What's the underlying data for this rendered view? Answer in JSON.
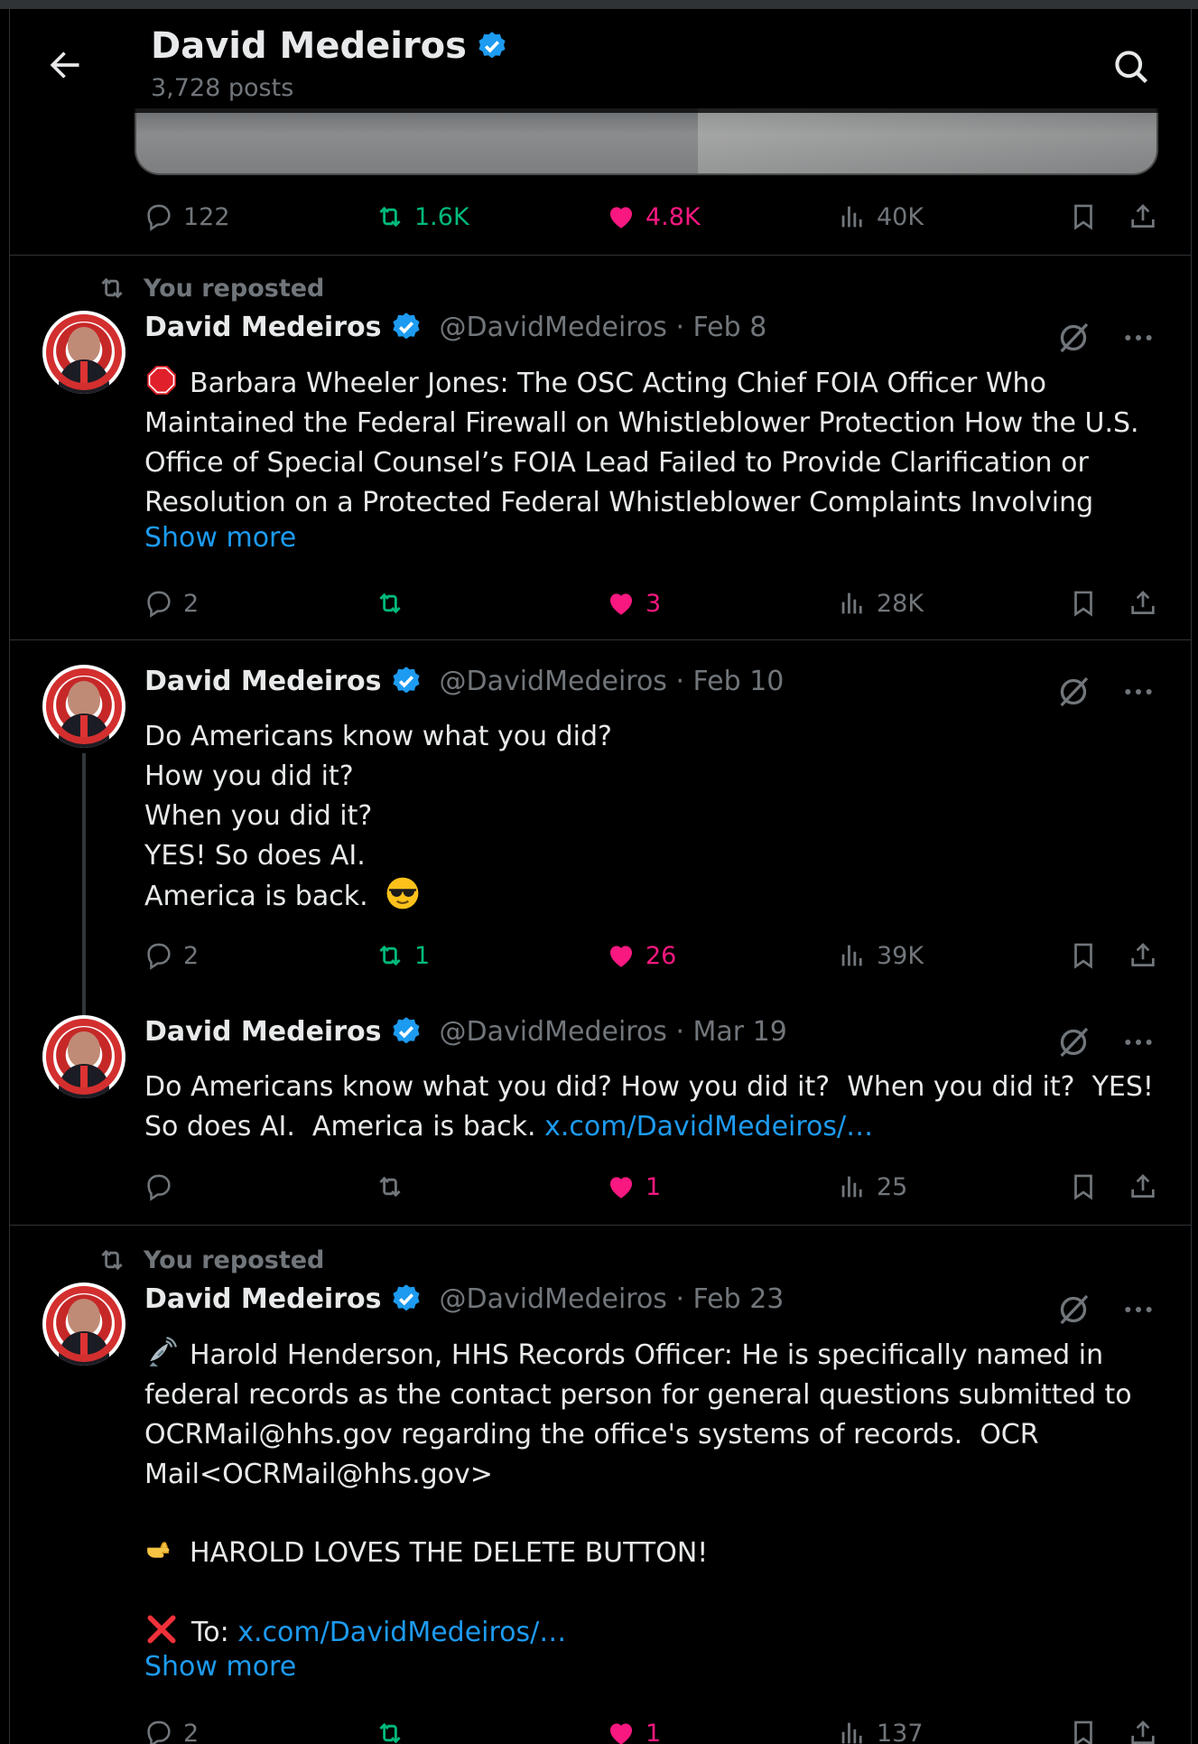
{
  "header": {
    "title": "David Medeiros",
    "posts_count": "3,728 posts",
    "back_icon": "arrow-left-icon",
    "search_icon": "search-icon"
  },
  "colors": {
    "background": "#000000",
    "text": "#e7e9ea",
    "muted": "#71767b",
    "accent_blue": "#1d9bf0",
    "repost_green": "#00ba7c",
    "like_pink": "#f91880",
    "divider": "#2f3336"
  },
  "posts": [
    {
      "metrics": {
        "replies": "122",
        "reposts": "1.6K",
        "likes": "4.8K",
        "views": "40K"
      }
    },
    {
      "reposted_label": "You reposted",
      "author": "David Medeiros",
      "handle_date": "@DavidMedeiros · Feb 8",
      "text": "Barbara Wheeler Jones: The OSC Acting Chief FOIA Officer Who\nMaintained the Federal Firewall on Whistleblower Protection How the U.S.\nOffice of Special Counsel’s FOIA Lead Failed to Provide Clarification or\nResolution on a Protected Federal Whistleblower Complaints Involving",
      "show_more": "Show more",
      "metrics": {
        "replies": "2",
        "reposts": "",
        "likes": "3",
        "views": "28K"
      }
    },
    {
      "author": "David Medeiros",
      "handle_date": "@DavidMedeiros · Feb 10",
      "text": "Do Americans know what you did?\nHow you did it?\nWhen you did it?\nYES! So does AI.\nAmerica is back.",
      "metrics": {
        "replies": "2",
        "reposts": "1",
        "likes": "26",
        "views": "39K"
      }
    },
    {
      "author": "David Medeiros",
      "handle_date": "@DavidMedeiros · Mar 19",
      "text": "Do Americans know what you did? How you did it?  When you did it?  YES!\nSo does AI.  America is back. ",
      "link": "x.com/DavidMedeiros/…",
      "metrics": {
        "replies": "",
        "reposts": "",
        "likes": "1",
        "views": "25"
      }
    },
    {
      "reposted_label": "You reposted",
      "author": "David Medeiros",
      "handle_date": "@DavidMedeiros · Feb 23",
      "text": "Harold Henderson, HHS Records Officer: He is specifically named in\nfederal records as the contact person for general questions submitted to\nOCRMail@hhs.gov regarding the office's systems of records.  OCR\nMail<OCRMail@hhs.gov>",
      "line2": "HAROLD LOVES THE DELETE BUTTON!",
      "line3_prefix": "To: ",
      "link": "x.com/DavidMedeiros/…",
      "show_more": "Show more",
      "metrics": {
        "replies": "2",
        "reposts": "",
        "likes": "1",
        "views": "137"
      }
    }
  ]
}
